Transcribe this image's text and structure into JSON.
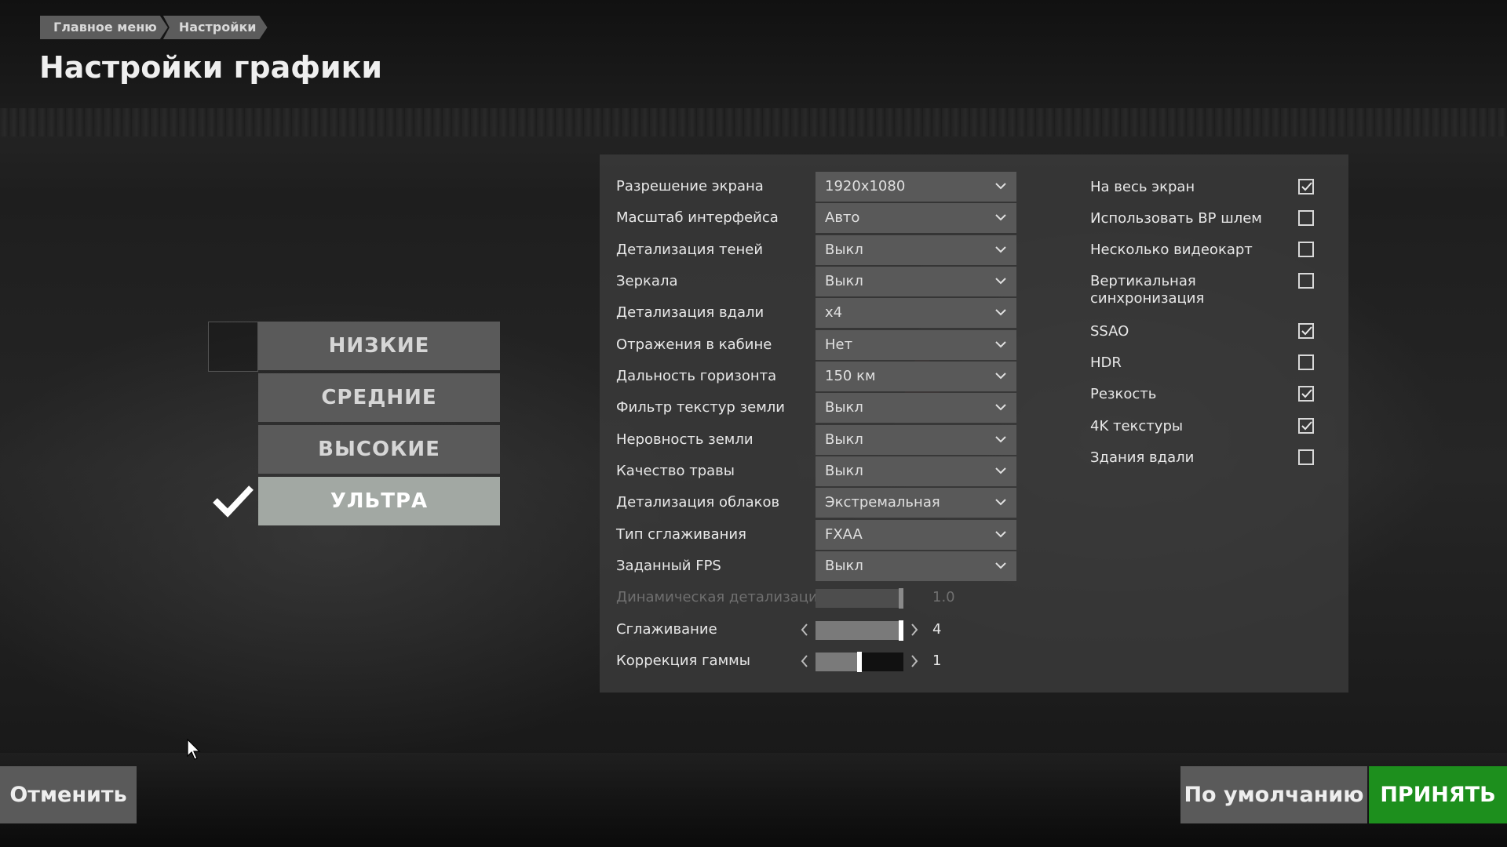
{
  "breadcrumb": [
    "Главное меню",
    "Настройки"
  ],
  "page_title": "Настройки графики",
  "presets": {
    "items": [
      "НИЗКИЕ",
      "СРЕДНИЕ",
      "ВЫСОКИЕ",
      "УЛЬТРА"
    ],
    "selected": "УЛЬТРА"
  },
  "settings": {
    "dropdowns": [
      {
        "label": "Разрешение экрана",
        "value": "1920x1080"
      },
      {
        "label": "Масштаб интерфейса",
        "value": "Авто"
      },
      {
        "label": "Детализация теней",
        "value": "Выкл"
      },
      {
        "label": "Зеркала",
        "value": "Выкл"
      },
      {
        "label": "Детализация вдали",
        "value": "x4"
      },
      {
        "label": "Отражения в кабине",
        "value": "Нет"
      },
      {
        "label": "Дальность горизонта",
        "value": "150 км"
      },
      {
        "label": "Фильтр текстур земли",
        "value": "Выкл"
      },
      {
        "label": "Неровность земли",
        "value": "Выкл"
      },
      {
        "label": "Качество травы",
        "value": "Выкл"
      },
      {
        "label": "Детализация облаков",
        "value": "Экстремальная"
      },
      {
        "label": "Тип сглаживания",
        "value": "FXAA"
      },
      {
        "label": "Заданный FPS",
        "value": "Выкл"
      }
    ],
    "sliders": [
      {
        "label": "Динамическая детализация",
        "value": "1.0",
        "level": 1.0,
        "disabled": true
      },
      {
        "label": "Сглаживание",
        "value": "4",
        "level": 1.0,
        "disabled": false
      },
      {
        "label": "Коррекция гаммы",
        "value": "1",
        "level": 0.5,
        "disabled": false
      }
    ],
    "checkboxes": [
      {
        "label": "На весь экран",
        "checked": true
      },
      {
        "label": "Использовать ВР шлем",
        "checked": false
      },
      {
        "label": "Несколько видеокарт",
        "checked": false
      },
      {
        "label": "Вертикальная синхронизация",
        "checked": false
      },
      {
        "label": "SSAO",
        "checked": true
      },
      {
        "label": "HDR",
        "checked": false
      },
      {
        "label": "Резкость",
        "checked": true
      },
      {
        "label": "4K текстуры",
        "checked": true
      },
      {
        "label": "Здания вдали",
        "checked": false
      }
    ]
  },
  "buttons": {
    "cancel": "Отменить",
    "default": "По умолчанию",
    "accept": "ПРИНЯТЬ"
  },
  "colors": {
    "accept": "#1d8f1d",
    "active_preset": "#a2a8a3"
  }
}
